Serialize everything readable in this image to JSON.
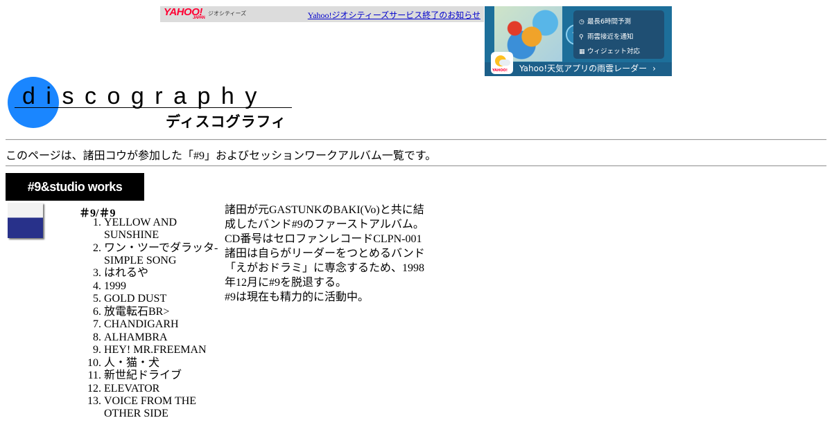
{
  "banner": {
    "brand_logo": "YAHOO!",
    "brand_sub": "JAPAN",
    "service_name": "ジオシティーズ",
    "notice_link": "Yahoo!ジオシティーズサービス終了のお知らせ"
  },
  "weather_ad": {
    "features": [
      "最長6時間予測",
      "雨雲接近を通知",
      "ウィジェット対応"
    ],
    "app_brand": "YAHOO!",
    "cta": "Yahoo!天気アプリの雨雲レーダー",
    "cta_arrow": "›"
  },
  "logo": {
    "word": "discography",
    "japanese": "ディスコグラフィ"
  },
  "intro": "このページは、諸田コウが参加した「#9」およびセッションワークアルバム一覧です。",
  "section": {
    "title": "#9&studio works"
  },
  "album": {
    "title": "＃9/＃9",
    "tracks": [
      "YELLOW AND SUNSHINE",
      "ワン・ツーでダラッタ-SIMPLE SONG",
      "はれるや",
      "1999",
      "GOLD DUST",
      "放電転石BR>",
      "CHANDIGARH",
      "ALHAMBRA",
      "HEY! MR.FREEMAN",
      "人・猫・犬",
      "新世紀ドライブ",
      "ELEVATOR",
      "VOICE FROM THE OTHER SIDE"
    ],
    "description": [
      "諸田が元GASTUNKのBAKI(Vo)と共に結成したバンド#9のファーストアルバム。",
      "CD番号はセロファンレコードCLPN-001",
      "諸田は自らがリーダーをつとめるバンド「えがおドラミ」に専念するため、1998年12月に#9を脱退する。",
      "#9は現在も精力的に活動中。"
    ]
  }
}
